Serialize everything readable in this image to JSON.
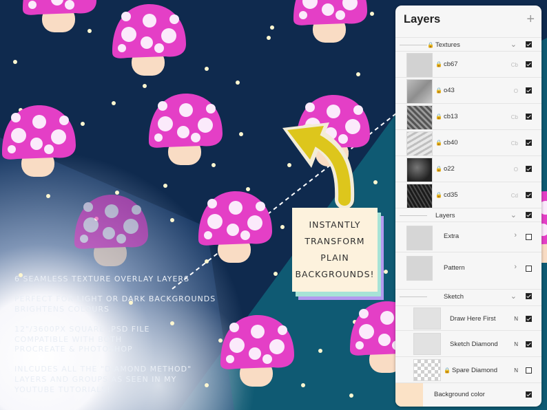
{
  "promo": {
    "features": [
      [
        "6 seamless texture overlay layers"
      ],
      [
        "perfect for light or dark backgrounds",
        "brightens colours"
      ],
      [
        "12\"/3600px square .PSD file",
        "compatible with both",
        "procreate & photoshop"
      ],
      [
        "inlcudes all the \"diamond method\"",
        "layers and groups as seen in my",
        "youtube tutorials!"
      ]
    ]
  },
  "callout": {
    "lines": [
      "INSTANTLY",
      "TRANSFORM",
      "PLAIN",
      "BACKGROUNDS!"
    ]
  },
  "layers_panel": {
    "title": "Layers",
    "add_icon": "plus-icon",
    "groups": [
      {
        "name": "Textures",
        "locked": true,
        "expanded": true,
        "visible": true
      },
      {
        "name": "Layers",
        "locked": false,
        "expanded": true,
        "visible": true
      },
      {
        "name": "Sketch",
        "locked": false,
        "expanded": true,
        "visible": true
      }
    ],
    "texture_layers": [
      {
        "name": "cb67",
        "mode": "Cb",
        "visible": true
      },
      {
        "name": "o43",
        "mode": "O",
        "visible": true
      },
      {
        "name": "cb13",
        "mode": "Cb",
        "visible": true
      },
      {
        "name": "cb40",
        "mode": "Cb",
        "visible": true
      },
      {
        "name": "o22",
        "mode": "O",
        "visible": true
      },
      {
        "name": "cd35",
        "mode": "Cd",
        "visible": true
      }
    ],
    "sub_groups": [
      {
        "name": "Extra",
        "visible": false
      },
      {
        "name": "Pattern",
        "visible": false
      }
    ],
    "sketch_layers": [
      {
        "name": "Draw Here First",
        "mode": "N",
        "visible": true
      },
      {
        "name": "Sketch Diamond",
        "mode": "N",
        "visible": true
      },
      {
        "name": "Spare Diamond",
        "mode": "N",
        "visible": false
      }
    ],
    "background": {
      "label": "Background color",
      "color": "#fbe2c6",
      "visible": true
    }
  },
  "colors": {
    "navy": "#0f2a4e",
    "teal": "#0f5a73",
    "mushroom_cap": "#e43fc6",
    "mushroom_spot": "#fbeafb",
    "mushroom_stem": "#f9dcc4",
    "arrow": "#ddc61c"
  }
}
